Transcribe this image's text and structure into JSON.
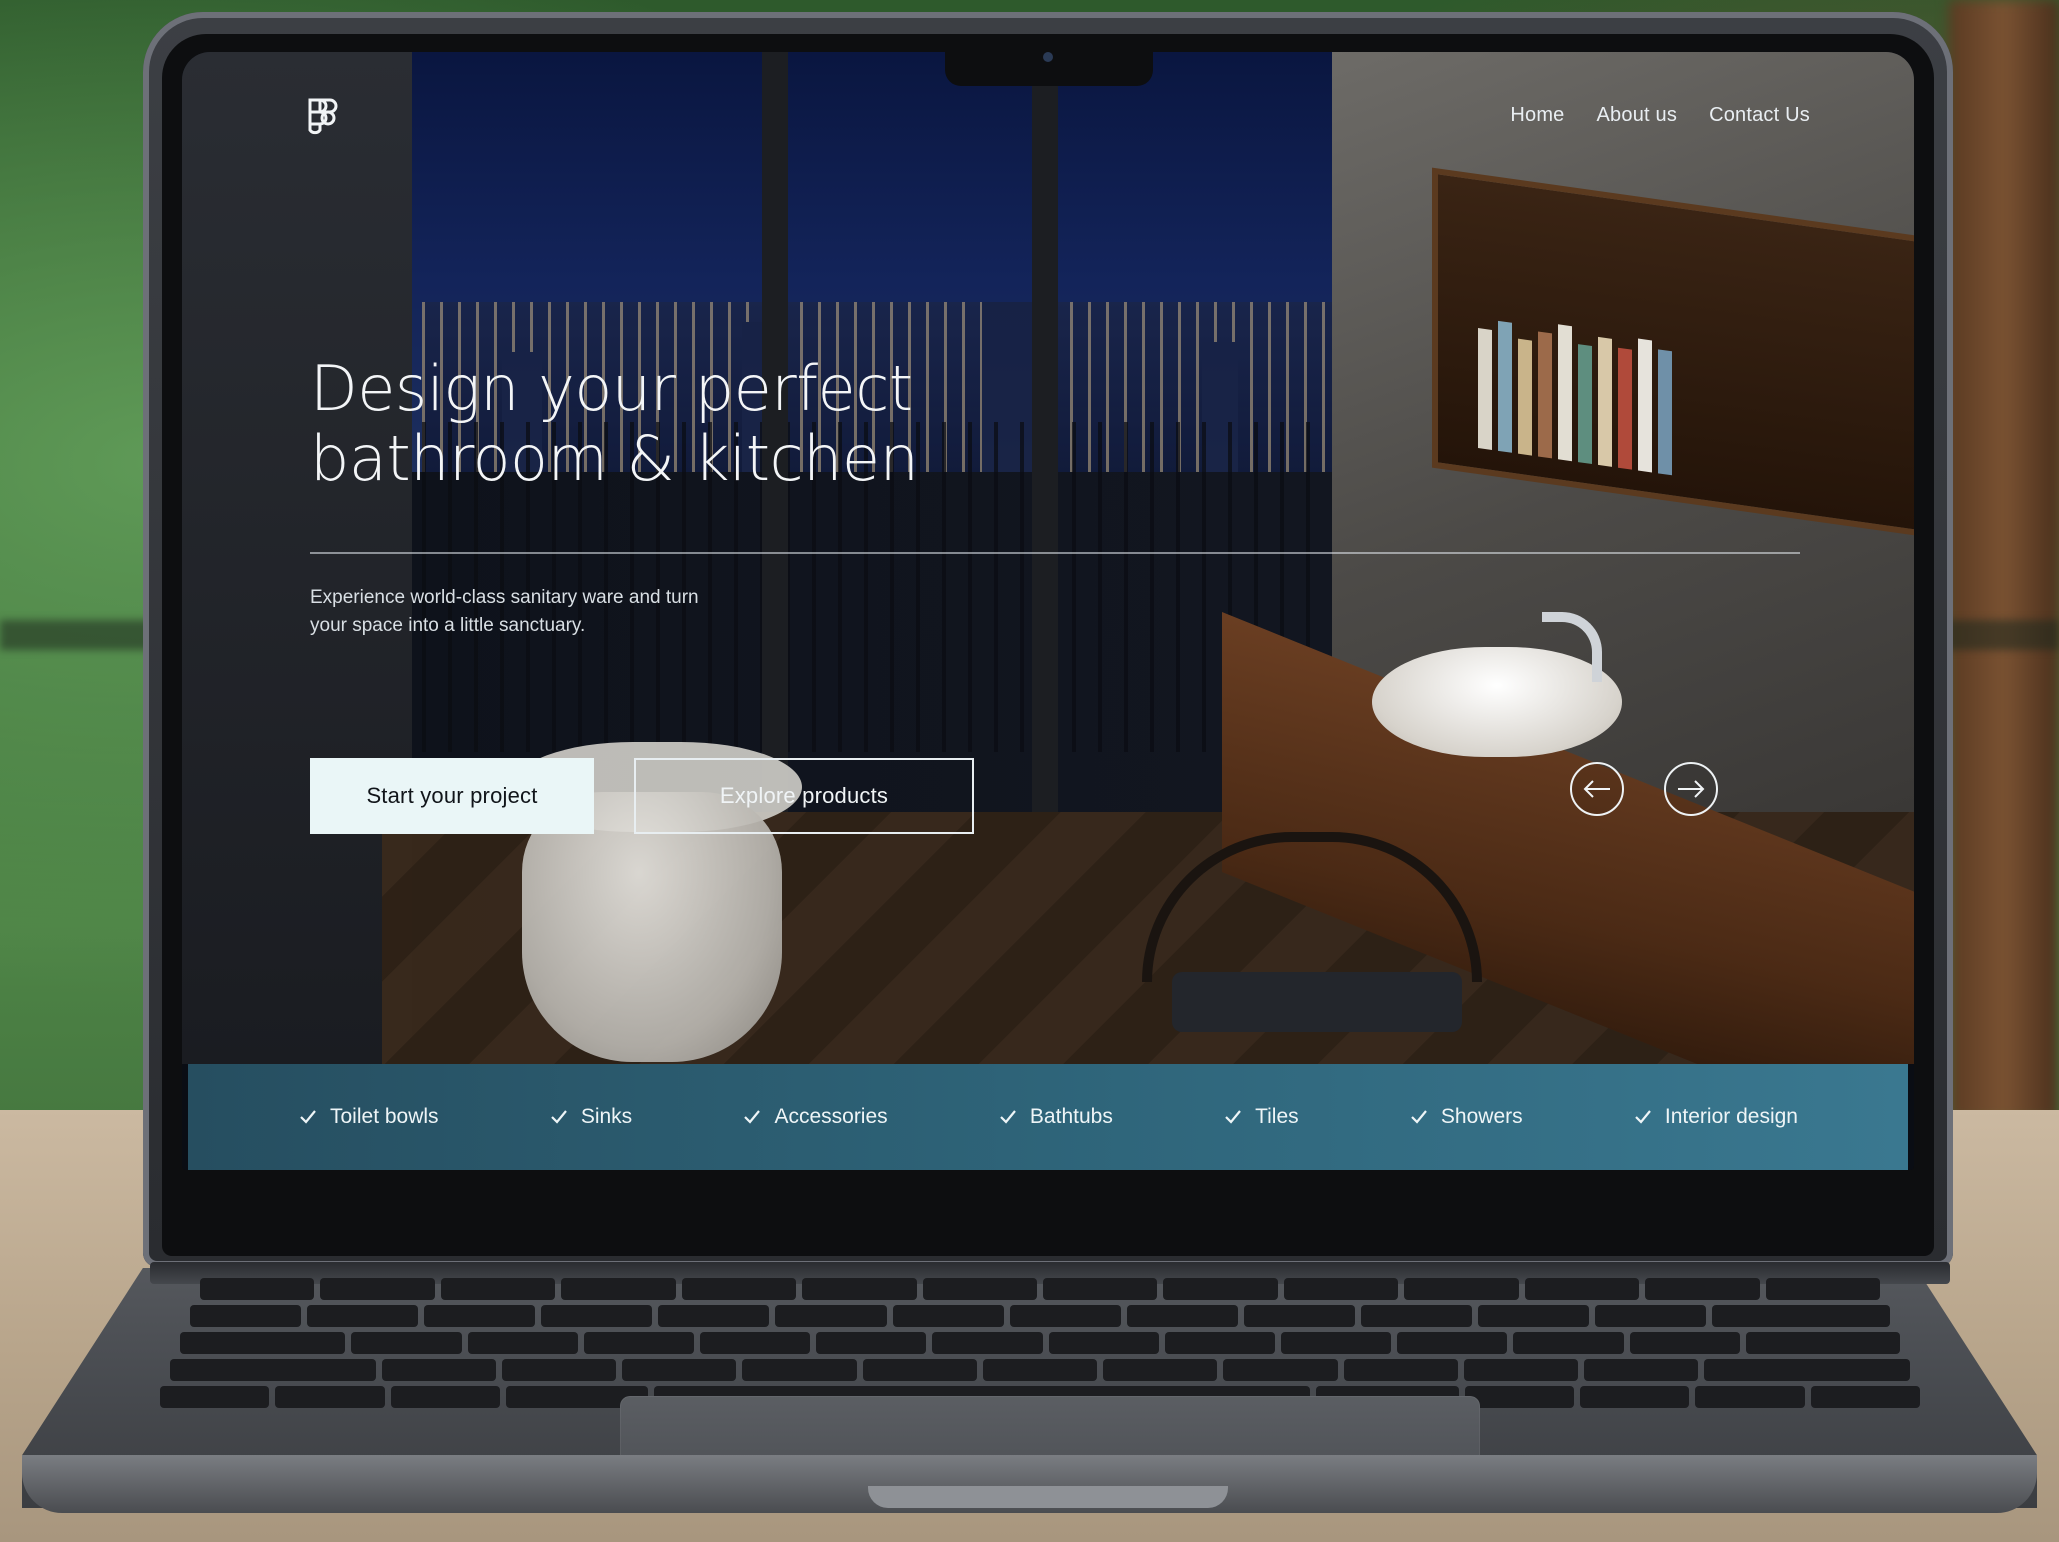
{
  "brand": {
    "logo_icon": "stacked-shapes-logo-icon"
  },
  "nav": {
    "items": [
      {
        "label": "Home"
      },
      {
        "label": "About us"
      },
      {
        "label": "Contact Us"
      }
    ]
  },
  "hero": {
    "headline_line1": "Design your perfect",
    "headline_line2": "bathroom & kitchen",
    "subtext": "Experience world-class sanitary ware and turn your space into a little sanctuary.",
    "primary_button": "Start your project",
    "secondary_button": "Explore products",
    "carousel_prev_icon": "arrow-left-icon",
    "carousel_next_icon": "arrow-right-icon"
  },
  "categories": {
    "items": [
      {
        "label": "Toilet bowls"
      },
      {
        "label": "Sinks"
      },
      {
        "label": "Accessories"
      },
      {
        "label": "Bathtubs"
      },
      {
        "label": "Tiles"
      },
      {
        "label": "Showers"
      },
      {
        "label": "Interior design"
      }
    ],
    "check_icon": "check-icon"
  },
  "colors": {
    "category_bar": "#2e6479",
    "primary_button_bg": "#eaf6f7",
    "text_light": "#f3f5f7"
  }
}
